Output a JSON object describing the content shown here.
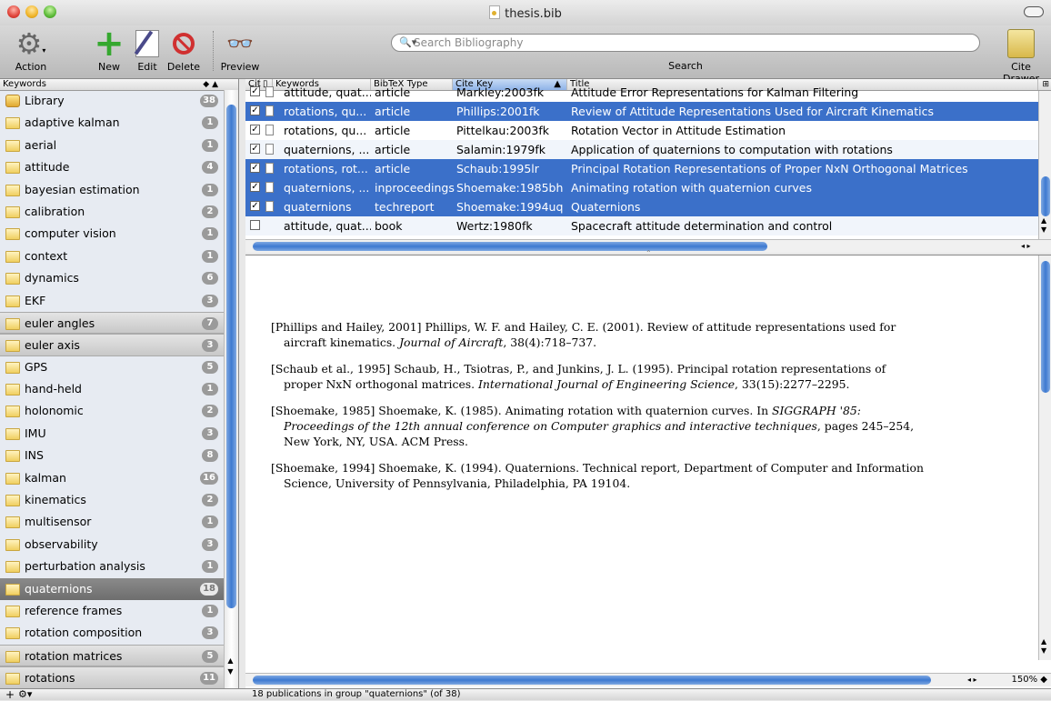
{
  "window": {
    "title": "thesis.bib"
  },
  "toolbar": {
    "action": "Action",
    "new": "New",
    "edit": "Edit",
    "delete": "Delete",
    "preview": "Preview",
    "search_placeholder": "Search Bibliography",
    "search_label": "Search",
    "cite_drawer": "Cite Drawer"
  },
  "sidebar": {
    "header": "Keywords",
    "items": [
      {
        "label": "Library",
        "count": "38",
        "icon": "library-icon"
      },
      {
        "label": "adaptive kalman",
        "count": "1"
      },
      {
        "label": "aerial",
        "count": "1"
      },
      {
        "label": "attitude",
        "count": "4"
      },
      {
        "label": "bayesian estimation",
        "count": "1"
      },
      {
        "label": "calibration",
        "count": "2"
      },
      {
        "label": "computer vision",
        "count": "1"
      },
      {
        "label": "context",
        "count": "1"
      },
      {
        "label": "dynamics",
        "count": "6"
      },
      {
        "label": "EKF",
        "count": "3"
      },
      {
        "label": "euler angles",
        "count": "7"
      },
      {
        "label": "euler axis",
        "count": "3"
      },
      {
        "label": "GPS",
        "count": "5"
      },
      {
        "label": "hand-held",
        "count": "1"
      },
      {
        "label": "holonomic",
        "count": "2"
      },
      {
        "label": "IMU",
        "count": "3"
      },
      {
        "label": "INS",
        "count": "8"
      },
      {
        "label": "kalman",
        "count": "16"
      },
      {
        "label": "kinematics",
        "count": "2"
      },
      {
        "label": "multisensor",
        "count": "1"
      },
      {
        "label": "observability",
        "count": "3"
      },
      {
        "label": "perturbation analysis",
        "count": "1"
      },
      {
        "label": "quaternions",
        "count": "18"
      },
      {
        "label": "reference frames",
        "count": "1"
      },
      {
        "label": "rotation composition",
        "count": "3"
      },
      {
        "label": "rotation matrices",
        "count": "5"
      },
      {
        "label": "rotations",
        "count": "11"
      }
    ]
  },
  "table": {
    "headers": {
      "cite": "Cit",
      "keywords": "Keywords",
      "type": "BibTeX Type",
      "key": "Cite Key",
      "title": "Title"
    },
    "rows": [
      {
        "checked": true,
        "keywords": "attitude, quat...",
        "type": "article",
        "key": "Markley:2003fk",
        "title": "Attitude Error Representations for Kalman Filtering"
      },
      {
        "checked": true,
        "keywords": "rotations, qu...",
        "type": "article",
        "key": "Phillips:2001fk",
        "title": "Review of Attitude Representations Used for Aircraft Kinematics"
      },
      {
        "checked": true,
        "keywords": "rotations, qu...",
        "type": "article",
        "key": "Pittelkau:2003fk",
        "title": "Rotation Vector in Attitude Estimation"
      },
      {
        "checked": true,
        "keywords": "quaternions, ...",
        "type": "article",
        "key": "Salamin:1979fk",
        "title": "Application of quaternions to computation with rotations"
      },
      {
        "checked": true,
        "keywords": "rotations, rot...",
        "type": "article",
        "key": "Schaub:1995lr",
        "title": "Principal Rotation Representations of Proper NxN Orthogonal Matrices"
      },
      {
        "checked": true,
        "keywords": "quaternions, ...",
        "type": "inproceedings",
        "key": "Shoemake:1985bh",
        "title": "Animating rotation with quaternion curves"
      },
      {
        "checked": true,
        "keywords": "quaternions",
        "type": "techreport",
        "key": "Shoemake:1994uq",
        "title": "Quaternions"
      },
      {
        "checked": false,
        "keywords": "attitude, quat...",
        "type": "book",
        "key": "Wertz:1980fk",
        "title": "Spacecraft attitude determination and control"
      }
    ]
  },
  "preview": {
    "refs": [
      {
        "pre": "[Phillips and Hailey, 2001]  Phillips, W. F. and Hailey, C. E. (2001).  Review of attitude representations used for aircraft kinematics. ",
        "em": "Journal of Aircraft",
        "post": ", 38(4):718–737."
      },
      {
        "pre": "[Schaub et al., 1995]  Schaub, H., Tsiotras, P., and Junkins, J. L. (1995).  Principal rotation representations of proper NxN orthogonal matrices. ",
        "em": "International Journal of Engineering Science",
        "post": ", 33(15):2277–2295."
      },
      {
        "pre": "[Shoemake, 1985]  Shoemake, K. (1985).  Animating rotation with quaternion curves.  In ",
        "em": "SIGGRAPH '85: Proceedings of the 12th annual conference on Computer graphics and interactive techniques",
        "post": ", pages 245–254, New York, NY, USA. ACM Press."
      },
      {
        "pre": "[Shoemake, 1994]  Shoemake, K. (1994).   Quaternions.   Technical report, Department of Computer and Information Science, University of Pennsylvania, Philadelphia, PA 19104.",
        "em": "",
        "post": ""
      }
    ],
    "zoom": "150%"
  },
  "status": {
    "text": "18 publications in group \"quaternions\" (of 38)"
  }
}
